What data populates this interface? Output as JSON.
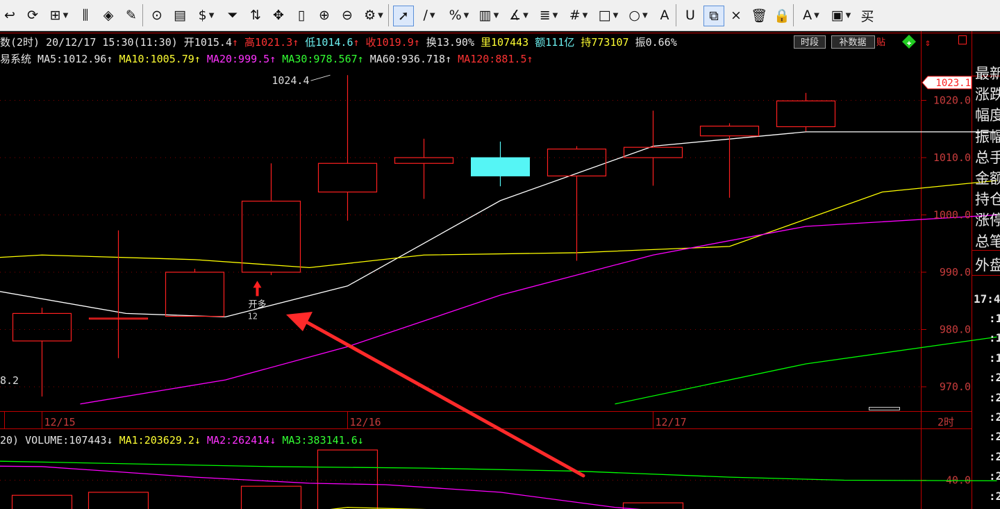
{
  "toolbar": {
    "items": [
      {
        "name": "undo-icon",
        "glyph": "↩"
      },
      {
        "name": "refresh-cycle-icon",
        "glyph": "⟳"
      },
      {
        "name": "layout-grid-icon",
        "glyph": "⊞",
        "dropdown": true
      },
      {
        "name": "candlestick-icon",
        "glyph": "⫼"
      },
      {
        "name": "diamond-tool-icon",
        "glyph": "◈"
      },
      {
        "name": "edit-icon",
        "glyph": "✎"
      },
      {
        "name": "play-icon",
        "glyph": "⊙"
      },
      {
        "name": "document-icon",
        "glyph": "▤"
      },
      {
        "name": "dollar-icon",
        "glyph": "$",
        "dropdown": true
      },
      {
        "name": "filter-icon",
        "glyph": "⏷"
      },
      {
        "name": "swap-icon",
        "glyph": "⇅"
      },
      {
        "name": "move-icon",
        "glyph": "✥"
      },
      {
        "name": "column-icon",
        "glyph": "▯"
      },
      {
        "name": "zoom-in-icon",
        "glyph": "⊕"
      },
      {
        "name": "zoom-out-icon",
        "glyph": "⊖"
      },
      {
        "name": "settings-icon",
        "glyph": "⚙",
        "dropdown": true
      },
      {
        "name": "cursor-select-icon",
        "glyph": "➚",
        "active": true
      },
      {
        "name": "line-tool-icon",
        "glyph": "∕",
        "dropdown": true
      },
      {
        "name": "percent-tool-icon",
        "glyph": "%",
        "dropdown": true
      },
      {
        "name": "ruler-tool-icon",
        "glyph": "▥",
        "dropdown": true
      },
      {
        "name": "angle-tool-icon",
        "glyph": "∡",
        "dropdown": true
      },
      {
        "name": "levels-tool-icon",
        "glyph": "≣",
        "dropdown": true
      },
      {
        "name": "grid-tool-icon",
        "glyph": "#",
        "dropdown": true
      },
      {
        "name": "rect-tool-icon",
        "glyph": "□",
        "dropdown": true
      },
      {
        "name": "circle-tool-icon",
        "glyph": "○",
        "dropdown": true
      },
      {
        "name": "text-tool-icon",
        "glyph": "A"
      },
      {
        "name": "magnet-icon",
        "glyph": "U"
      },
      {
        "name": "copy-icon",
        "glyph": "⧉",
        "active": true
      },
      {
        "name": "delete-icon",
        "glyph": "×"
      },
      {
        "name": "trash-icon",
        "glyph": "🗑"
      },
      {
        "name": "lock-icon",
        "glyph": "🔒"
      },
      {
        "name": "font-color-icon",
        "glyph": "A",
        "dropdown": true
      },
      {
        "name": "save-icon",
        "glyph": "▣",
        "dropdown": true
      },
      {
        "name": "buy-icon",
        "glyph": "买"
      }
    ]
  },
  "info_line": {
    "segments": [
      {
        "text": "数(2时) 20/12/17 15:30(11:30) 开1015.4",
        "color": "#e6e6e6"
      },
      {
        "text": "↑",
        "color": "#ff3333"
      },
      {
        "text": "高1021.3",
        "color": "#ff3333"
      },
      {
        "text": "↑",
        "color": "#ff3333"
      },
      {
        "text": "低1014.6",
        "color": "#6cf0f0"
      },
      {
        "text": "↑",
        "color": "#ff3333"
      },
      {
        "text": "收1019.9",
        "color": "#ff3333"
      },
      {
        "text": "↑",
        "color": "#ff3333"
      },
      {
        "text": "换13.90%",
        "color": "#e6e6e6"
      },
      {
        "text": "里107443",
        "color": "#ffff33"
      },
      {
        "text": "额111亿",
        "color": "#6cf0f0"
      },
      {
        "text": "持773107",
        "color": "#ffff33"
      },
      {
        "text": "振0.66%",
        "color": "#e6e6e6"
      }
    ],
    "tag_period": "时段",
    "tag_data": "补数据",
    "tag_tail": "贴"
  },
  "ma_line": {
    "segments": [
      {
        "text": "易系统",
        "color": "#e6e6e6"
      },
      {
        "text": "MA5:1012.96",
        "color": "#e6e6e6"
      },
      {
        "text": "↑",
        "color": "#e6e6e6"
      },
      {
        "text": "MA10:1005.79",
        "color": "#ffff33"
      },
      {
        "text": "↑",
        "color": "#ffff33"
      },
      {
        "text": "MA20:999.5",
        "color": "#ff33ff"
      },
      {
        "text": "↑",
        "color": "#ff33ff"
      },
      {
        "text": "MA30:978.567",
        "color": "#33ff33"
      },
      {
        "text": "↑",
        "color": "#33ff33"
      },
      {
        "text": "MA60:936.718",
        "color": "#e6e6e6"
      },
      {
        "text": "↑",
        "color": "#e6e6e6"
      },
      {
        "text": "MA120:881.5",
        "color": "#ff3333"
      },
      {
        "text": "↑",
        "color": "#ff3333"
      }
    ]
  },
  "volume_line": {
    "segments": [
      {
        "text": "20) VOLUME:107443",
        "color": "#e6e6e6"
      },
      {
        "text": "↓",
        "color": "#e6e6e6"
      },
      {
        "text": "MA1:203629.2",
        "color": "#ffff33"
      },
      {
        "text": "↓",
        "color": "#ffff33"
      },
      {
        "text": "MA2:262414",
        "color": "#ff33ff"
      },
      {
        "text": "↓",
        "color": "#ff33ff"
      },
      {
        "text": "MA3:383141.6",
        "color": "#33ff33"
      },
      {
        "text": "↓",
        "color": "#33ff33"
      }
    ]
  },
  "colors": {
    "up": "#ff2020",
    "down": "#55f5f5",
    "grid": "#8a0000",
    "axis": "#c00000",
    "label": "#c83c3c",
    "ma5": "#ffffff",
    "ma10": "#ffff00",
    "ma20": "#ff00ff",
    "ma30": "#00ff00"
  },
  "chart_data": {
    "type": "candlestick",
    "price_ticks": [
      970.0,
      980.0,
      990.0,
      1000.0,
      1010.0,
      1020.0
    ],
    "price_ticks_text": [
      "970.0",
      "980.0",
      "990.0",
      "1000.0",
      "1010.0",
      "1020.0"
    ],
    "current_price_label": "1023.1",
    "current_price": 1023.1,
    "high_label": "1024.4",
    "low_label_partial": "8.2",
    "date_labels": [
      "12/15",
      "12/16",
      "12/17"
    ],
    "period_label": "2时",
    "candles": [
      {
        "open": 978.0,
        "close": 982.8,
        "high": 983.8,
        "low": 968.3,
        "dir": "up"
      },
      {
        "open": 982.0,
        "close": 982.0,
        "high": 997.3,
        "low": 975.0,
        "dir": "doji"
      },
      {
        "open": 982.3,
        "close": 990.0,
        "high": 990.6,
        "low": 982.3,
        "dir": "up"
      },
      {
        "open": 990.0,
        "close": 1002.4,
        "high": 1009.0,
        "low": 989.5,
        "dir": "up"
      },
      {
        "open": 1004.0,
        "close": 1009.0,
        "high": 1024.4,
        "low": 999.0,
        "dir": "up"
      },
      {
        "open": 1009.0,
        "close": 1010.0,
        "high": 1013.3,
        "low": 1002.8,
        "dir": "up"
      },
      {
        "open": 1010.0,
        "close": 1006.8,
        "high": 1012.8,
        "low": 1005.0,
        "dir": "down"
      },
      {
        "open": 1006.8,
        "close": 1011.5,
        "high": 1012.0,
        "low": 992.0,
        "dir": "up"
      },
      {
        "open": 1010.0,
        "close": 1011.8,
        "high": 1018.2,
        "low": 1005.1,
        "dir": "up"
      },
      {
        "open": 1013.8,
        "close": 1015.5,
        "high": 1016.0,
        "low": 1003.0,
        "dir": "up"
      },
      {
        "open": 1015.4,
        "close": 1019.9,
        "high": 1021.3,
        "low": 1014.6,
        "dir": "up"
      }
    ],
    "series": [
      {
        "name": "MA5",
        "points": [
          [
            -2,
            990.0
          ],
          [
            1.1,
            982.8
          ],
          [
            2.4,
            982.2
          ],
          [
            4.0,
            987.6
          ],
          [
            6.0,
            1002.5
          ],
          [
            8.0,
            1012.0
          ],
          [
            10.0,
            1014.5
          ],
          [
            12.5,
            1014.5
          ]
        ]
      },
      {
        "name": "MA10",
        "points": [
          [
            -2,
            991.5
          ],
          [
            0.0,
            993.0
          ],
          [
            2.0,
            992.2
          ],
          [
            3.5,
            990.8
          ],
          [
            5.0,
            993.0
          ],
          [
            7.0,
            993.4
          ],
          [
            9.0,
            994.5
          ],
          [
            11.0,
            1004.0
          ],
          [
            12.5,
            1006.0
          ]
        ]
      },
      {
        "name": "MA20",
        "points": [
          [
            0.5,
            967.0
          ],
          [
            2.4,
            971.2
          ],
          [
            4.0,
            977.0
          ],
          [
            6.0,
            986.0
          ],
          [
            8.0,
            993.0
          ],
          [
            10.0,
            998.0
          ],
          [
            12.5,
            1000.0
          ]
        ]
      },
      {
        "name": "MA30",
        "points": [
          [
            7.5,
            967.0
          ],
          [
            10.0,
            974.0
          ],
          [
            12.5,
            978.7
          ]
        ]
      }
    ],
    "signal": {
      "label": "开多",
      "sub": "12",
      "price": 988.5
    },
    "volume": {
      "tick_text": "40.0",
      "tick_value": 40.0,
      "bars": [
        {
          "slot": 0,
          "top": 35.0
        },
        {
          "slot": 1,
          "top": 36.0
        },
        {
          "slot": 3,
          "top": 38.0
        },
        {
          "slot": 4,
          "top": 50.0
        },
        {
          "slot": 8,
          "top": 32.5
        }
      ],
      "series": [
        {
          "name": "MA1",
          "points": [
            [
              -2,
              27.0
            ],
            [
              0.0,
              26.0
            ],
            [
              2.0,
              25.0
            ],
            [
              4.0,
              31.0
            ],
            [
              5.5,
              30.0
            ],
            [
              7.0,
              28.0
            ],
            [
              8.5,
              30.0
            ],
            [
              10.5,
              25.0
            ]
          ]
        },
        {
          "name": "MA2",
          "points": [
            [
              -2,
              45.0
            ],
            [
              0.0,
              44.5
            ],
            [
              2.0,
              41.0
            ],
            [
              3.5,
              39.0
            ],
            [
              4.5,
              38.5
            ],
            [
              6.0,
              36.0
            ],
            [
              7.5,
              31.0
            ],
            [
              9.0,
              28.0
            ]
          ]
        },
        {
          "name": "MA3",
          "points": [
            [
              -2,
              47.0
            ],
            [
              0.0,
              46.0
            ],
            [
              3.0,
              44.5
            ],
            [
              5.0,
              44.0
            ],
            [
              7.0,
              43.0
            ],
            [
              9.0,
              41.0
            ],
            [
              10.5,
              40.0
            ],
            [
              12.5,
              39.8
            ]
          ]
        }
      ]
    }
  },
  "right_panel": {
    "labels": [
      "最新",
      "涨跌",
      "幅度",
      "振幅",
      "总手",
      "金额",
      "持仓",
      "涨停",
      "总笔"
    ],
    "outer": "外盘",
    "time": "17:4",
    "ticks": [
      ":1",
      ":1",
      ":1",
      ":2",
      ":2",
      ":2",
      ":2",
      ":2",
      ":2",
      ":2"
    ]
  }
}
